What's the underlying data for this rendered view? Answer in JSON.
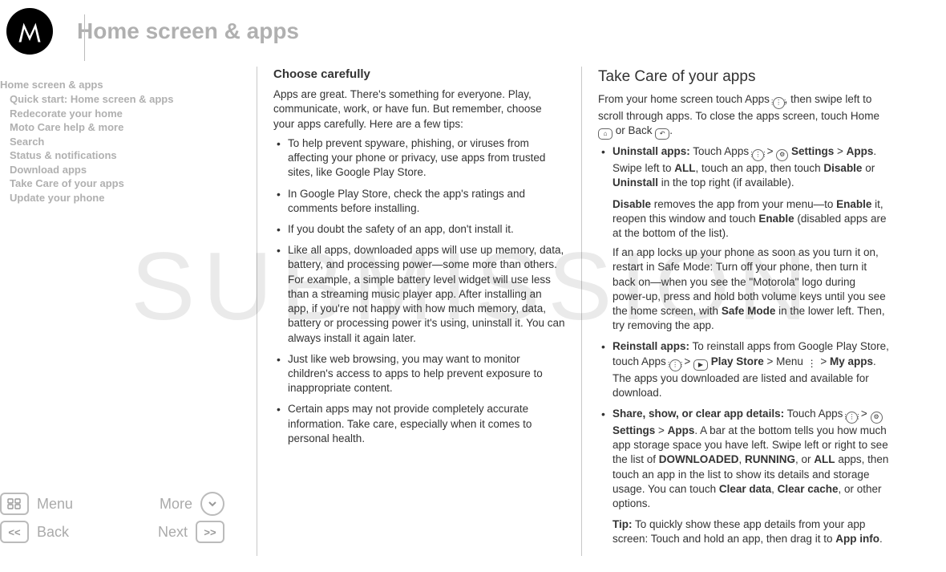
{
  "header": {
    "title": "Home screen & apps"
  },
  "toc": {
    "heading": "Home screen & apps",
    "items": [
      "Quick start: Home screen & apps",
      "Redecorate your home",
      "Moto Care help & more",
      "Search",
      "Status & notifications",
      "Download apps",
      "Take Care of your apps",
      "Update your phone"
    ]
  },
  "nav": {
    "menu": "Menu",
    "more": "More",
    "back": "Back",
    "next": "Next"
  },
  "col1": {
    "heading": "Choose carefully",
    "intro": "Apps are great. There's something for everyone. Play, communicate, work, or have fun. But remember, choose your apps carefully. Here are a few tips:",
    "bullets": [
      "To help prevent spyware, phishing, or viruses from affecting your phone or privacy, use apps from trusted sites, like Google Play Store.",
      "In Google Play Store, check the app's ratings and comments before installing.",
      "If you doubt the safety of an app, don't install it.",
      "Like all apps, downloaded apps will use up memory, data, battery, and processing power—some more than others. For example, a simple battery level widget will use less than a streaming music player app. After installing an app, if you're not happy with how much memory, data, battery or processing power it's using, uninstall it. You can always install it again later.",
      "Just like web browsing, you may want to monitor children's access to apps to help prevent exposure to inappropriate content.",
      "Certain apps may not provide completely accurate information. Take care, especially when it comes to personal health."
    ]
  },
  "col2": {
    "heading": "Take Care of your apps",
    "intro_a": "From your home screen touch Apps ",
    "intro_b": ", then swipe left to scroll through apps. To close the apps screen, touch Home ",
    "intro_c": " or Back ",
    "intro_d": ".",
    "item1": {
      "lead": "Uninstall apps:",
      "t1": " Touch Apps ",
      "t2": " > ",
      "t3": " Settings",
      "t4": " > ",
      "t5": "Apps",
      "t6": ". Swipe left to ",
      "t7": "ALL",
      "t8": ", touch an app, then touch ",
      "t9": "Disable",
      "t10": " or ",
      "t11": "Uninstall",
      "t12": " in the top right (if available)."
    },
    "item1_p2": {
      "t1": "Disable",
      "t2": " removes the app from your menu—to ",
      "t3": "Enable",
      "t4": " it, reopen this window and touch ",
      "t5": "Enable",
      "t6": " (disabled apps are at the bottom of the list)."
    },
    "item1_p3": "If an app locks up your phone as soon as you turn it on, restart in Safe Mode: Turn off your phone, then turn it back on—when you see the \"Motorola\" logo during power-up, press and hold both volume keys until you see the home screen, with ",
    "item1_p3b": "Safe Mode",
    "item1_p3c": " in the lower left. Then, try removing the app.",
    "item2": {
      "lead": "Reinstall apps:",
      "t1": " To reinstall apps from Google Play Store, touch Apps ",
      "t2": " > ",
      "t3": " Play Store",
      "t4": " > Menu ",
      "t5": " > ",
      "t6": "My apps",
      "t7": ". The apps you downloaded are listed and available for download."
    },
    "item3": {
      "lead": "Share, show, or clear app details:",
      "t1": " Touch Apps ",
      "t2": " > ",
      "t3": " Settings",
      "t4": " > ",
      "t5": "Apps",
      "t6": ". A bar at the bottom tells you how much app storage space you have left. Swipe left or right to see the list of ",
      "t7": "DOWNLOADED",
      "t8": ", ",
      "t9": "RUNNING",
      "t10": ", or ",
      "t11": "ALL",
      "t12": " apps, then touch an app in the list to show its details and storage usage. You can touch ",
      "t13": "Clear data",
      "t14": ", ",
      "t15": "Clear cache",
      "t16": ", or other options."
    },
    "tip": {
      "lead": "Tip:",
      "t1": " To quickly show these app details from your app screen: Touch and hold an app, then drag it to ",
      "t2": "App info",
      "t3": "."
    }
  }
}
